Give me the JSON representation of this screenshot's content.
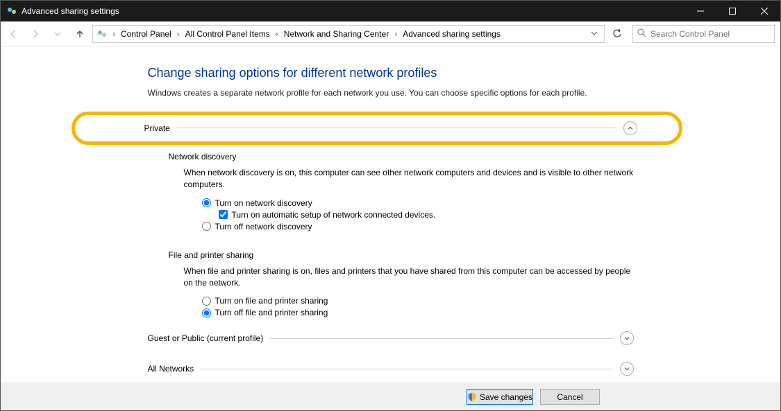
{
  "window": {
    "title": "Advanced sharing settings"
  },
  "breadcrumbs": {
    "items": [
      "Control Panel",
      "All Control Panel Items",
      "Network and Sharing Center",
      "Advanced sharing settings"
    ]
  },
  "search": {
    "placeholder": "Search Control Panel"
  },
  "page": {
    "heading": "Change sharing options for different network profiles",
    "subheading": "Windows creates a separate network profile for each network you use. You can choose specific options for each profile."
  },
  "profiles": {
    "private": {
      "label": "Private",
      "network_discovery": {
        "title": "Network discovery",
        "desc": "When network discovery is on, this computer can see other network computers and devices and is visible to other network computers.",
        "on_label": "Turn on network discovery",
        "auto_label": "Turn on automatic setup of network connected devices.",
        "off_label": "Turn off network discovery",
        "selected": "on",
        "auto_checked": true
      },
      "file_printer": {
        "title": "File and printer sharing",
        "desc": "When file and printer sharing is on, files and printers that you have shared from this computer can be accessed by people on the network.",
        "on_label": "Turn on file and printer sharing",
        "off_label": "Turn off file and printer sharing",
        "selected": "off"
      }
    },
    "guest": {
      "label": "Guest or Public (current profile)"
    },
    "all": {
      "label": "All Networks"
    }
  },
  "footer": {
    "save": "Save changes",
    "cancel": "Cancel"
  }
}
